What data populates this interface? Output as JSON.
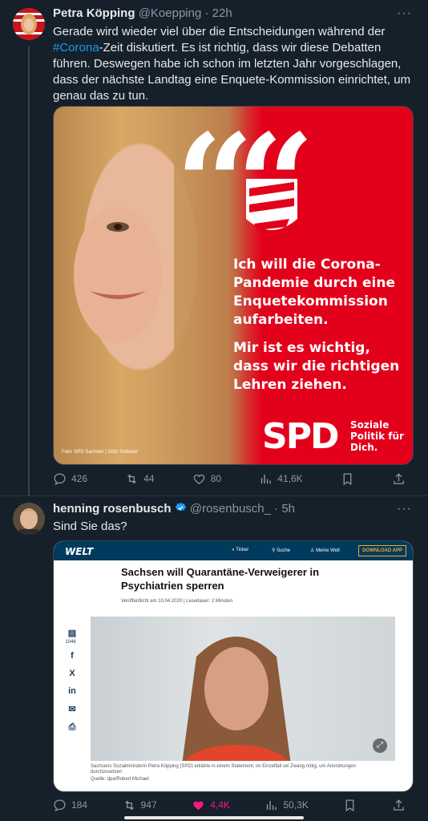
{
  "tweet1": {
    "name": "Petra Köpping",
    "handle": "@Koepping",
    "time": "22h",
    "text_before": "Gerade wird wieder viel über die Entscheidungen während der ",
    "hashtag": "#Corona",
    "text_after": "-Zeit diskutiert. Es ist richtig, dass wir diese Debatten führen. Deswegen habe ich schon im letzten Jahr vorgeschlagen, dass der nächste Landtag eine Enquete-Kommission einrichtet, um genau das zu tun.",
    "image": {
      "quote_text_1": "Ich will die Corona-Pandemie durch eine Enquetekommission aufarbeiten.",
      "quote_text_2": "Mir ist es wichtig, dass wir die richtigen Lehren ziehen.",
      "logo": "SPD",
      "slogan": "Soziale Politik für Dich.",
      "credit": "Foto: SPD Sachsen | Götz Schleser"
    },
    "replies": "426",
    "retweets": "44",
    "likes": "80",
    "views": "41,6K"
  },
  "tweet2": {
    "name": "henning rosenbusch",
    "handle": "@rosenbusch_",
    "time": "5h",
    "text": "Sind Sie das?",
    "card": {
      "logo": "WELT",
      "nav_ticker": "Ticker",
      "nav_search": "Suche",
      "nav_account": "Meine Welt",
      "download": "DOWNLOAD APP",
      "headline": "Sachsen will Quarantäne-Verweigerer in Psychiatrien sperren",
      "meta": "Veröffentlicht am 10.04.2020 | Lesedauer: 2 Minuten",
      "comments": "1046",
      "caption": "Sachsens Sozialministerin Petra Köpping (SPD) erklärte in einem Statement, im Einzelfall sei Zwang nötig, um Anordnungen durchzusetzen",
      "source": "Quelle: dpa/Robert Michael"
    },
    "replies": "184",
    "retweets": "947",
    "likes": "4,4K",
    "views": "50,3K"
  },
  "colors": {
    "accent": "#1d9bf0",
    "like": "#f91880",
    "spd_red": "#e3001b",
    "welt_blue": "#003a5d"
  }
}
